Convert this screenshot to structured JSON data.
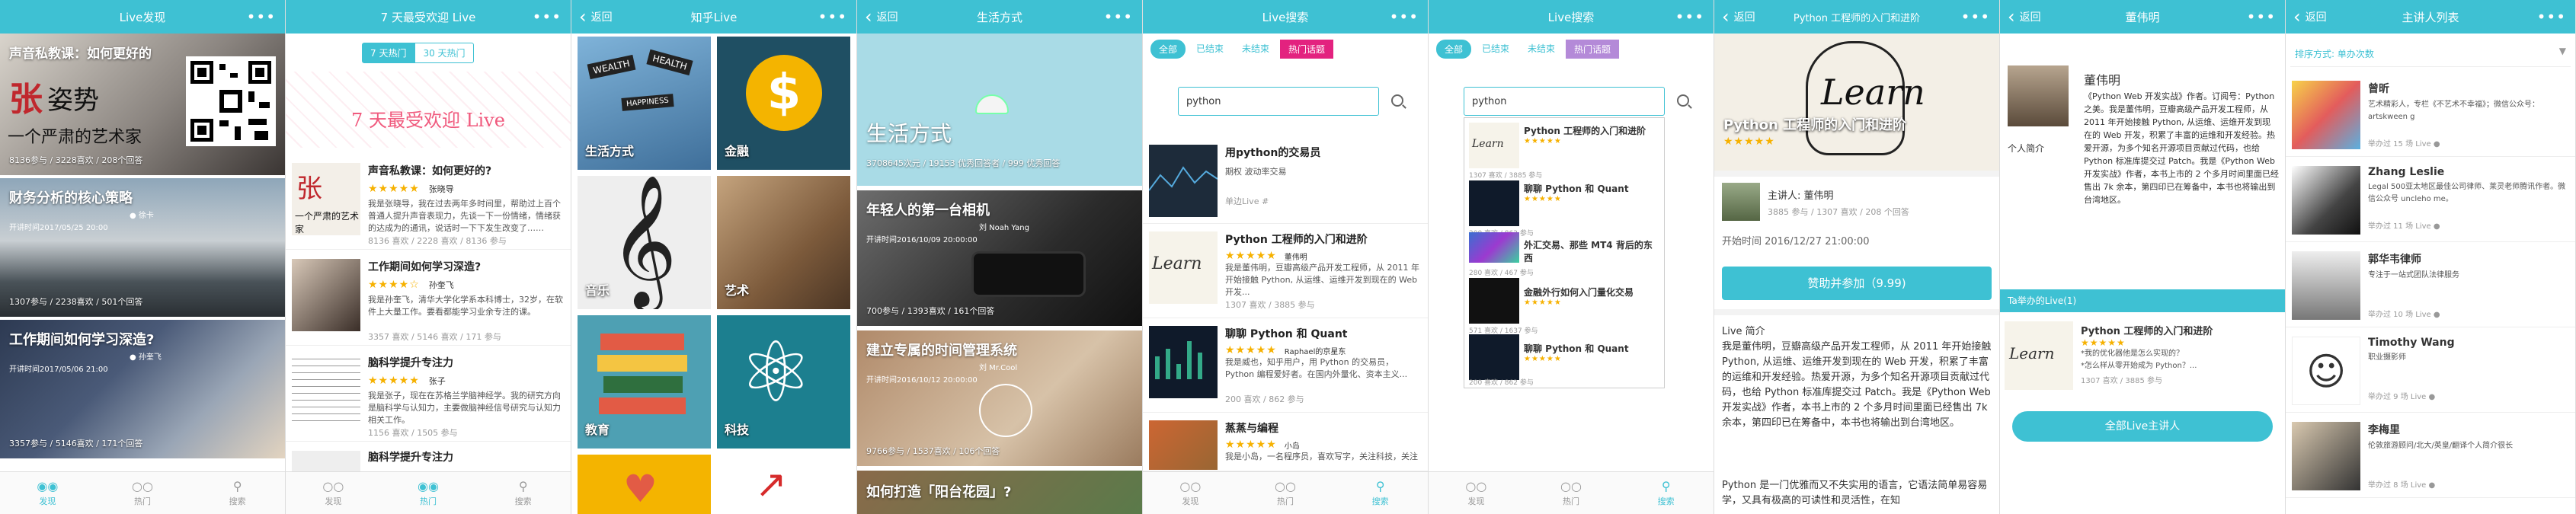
{
  "s1": {
    "title": "Live发现",
    "dots": "•••",
    "card1": {
      "title": "声音私教课：如何更好的",
      "meta": "8136参与 / 3228喜欢 / 208个回答",
      "logo_chars": "张",
      "tagline": "一个严肃的艺术家"
    },
    "card2": {
      "title": "财务分析的核心策略",
      "who": "● 徐卡",
      "date": "开讲时间2017/05/25 20:00",
      "meta": "1307参与 / 2238喜欢 / 501个回答"
    },
    "card3": {
      "title": "工作期间如何学习深造?",
      "who": "● 孙奎飞",
      "date": "开讲时间2017/05/06 21:00",
      "meta": "3357参与 / 5146喜欢 / 171个回答"
    },
    "tabs": [
      "发现",
      "热门",
      "搜索"
    ]
  },
  "s2": {
    "title": "7 天最受欢迎 Live",
    "dots": "•••",
    "seg": [
      "7 天热门",
      "30 天热门"
    ],
    "headline": "7 天最受欢迎 Live",
    "items": [
      {
        "title": "声音私教课：如何更好的?",
        "who": "张晓导",
        "desc": "我是张晓导，我在过去两年多时间里，帮助过上百个普通人提升声音表现力，先谈一下一份情绪，情绪获的达成为的通讯，说话时一下下发生改变了……",
        "meta": "8136 喜欢 / 2228 喜欢 / 8136 参与"
      },
      {
        "title": "工作期间如何学习深造?",
        "who": "孙奎飞",
        "desc": "我是孙奎飞，清华大学化学系本科博士，32岁，在软件上大量工作。要看都能学习业余专注的课。",
        "meta": "3357 喜欢 / 5146 喜欢 / 171 参与"
      },
      {
        "title": "脑科学提升专注力",
        "who": "张子",
        "desc": "我是张子，现在在苏格兰学脑神经学。我的研究方向是脑科学与认知力，主要做脑神经信号研究与认知力相关工作。",
        "meta": "1156 喜欢 / 1505 参与"
      },
      {
        "title": "脑科学提升专注力"
      }
    ],
    "tabs": [
      "发现",
      "热门",
      "搜索"
    ]
  },
  "s3": {
    "title": "知乎Live",
    "dots": "•••",
    "tiles": [
      "生活方式",
      "金融",
      "音乐",
      "艺术",
      "教育",
      "科技",
      "",
      ""
    ],
    "tabs": [
      "发现",
      "热门",
      "搜索"
    ]
  },
  "s4": {
    "title": "生活方式",
    "back": "返回",
    "dots": "•••",
    "hero": {
      "title": "生活方式",
      "meta": "3708645次元 / 19153 优秀回答者 / 999 优秀回答"
    },
    "card1": {
      "title": "年轻人的第一台相机",
      "who": "刘 Noah Yang",
      "date": "开讲时间2016/10/09 20:00:00",
      "meta": "700参与 / 1393喜欢 / 161个回答"
    },
    "card2": {
      "title": "建立专属的时间管理系统",
      "who": "刘 Mr.Cool",
      "date": "开讲时间2016/10/12 20:00:00",
      "meta": "9766参与 / 1537喜欢 / 106个回答"
    },
    "card3": {
      "title": "如何打造「阳台花园」?"
    }
  },
  "s5": {
    "title": "Live搜索",
    "dots": "•••",
    "filters": [
      "全部",
      "已结束",
      "未结束",
      "热门话题"
    ],
    "query": "python",
    "items": [
      {
        "title": "用python的交易员",
        "desc": "期权 波动率交易",
        "meta": "单边Live #"
      },
      {
        "title": "Python 工程师的入门和进阶",
        "who": "董伟明",
        "stars": "★★★★★",
        "desc": "我是董伟明，豆瓣高级产品开发工程师，从 2011 年开始接触 Python, 从运维、运维开发到现在的 Web 开发...",
        "meta": "1307 喜欢 / 3885 参与"
      },
      {
        "title": "聊聊 Python 和 Quant",
        "who": "Raphael的京星东",
        "stars": "★★★★★",
        "desc": "我是威也，知乎用户，用 Python 的交易员，Python 编程爱好者。在国内外量化、资本主义...",
        "meta": "200 喜欢 / 862 参与"
      },
      {
        "title": "蒸蒸与编程",
        "who": "小岛",
        "stars": "★★★★★",
        "desc": "我是小岛，一名程序员，喜欢写字，关注科技，关注书法与编程的相似之处...",
        "meta": "1307 喜欢 / 3885 参与"
      }
    ],
    "tabs": [
      "发现",
      "热门",
      "搜索"
    ]
  },
  "s6": {
    "title": "Live搜索",
    "dots": "•••",
    "filters": [
      "全部",
      "已结束",
      "未结束",
      "热门话题"
    ],
    "query": "python",
    "items": [
      {
        "title": "Python 工程师的入门和进阶",
        "meta": "1307 喜欢 / 3885 参与"
      },
      {
        "title": "聊聊 Python 和 Quant",
        "meta": "200 喜欢 / 862 参与"
      },
      {
        "title": "外汇交易、那些 MT4 背后的东西",
        "meta": "280 喜欢 / 467 参与"
      },
      {
        "title": "金融外行如何入门量化交易",
        "meta": "571 喜欢 / 1637 参与"
      },
      {
        "title": "聊聊 Python 和 Quant",
        "meta": "200 喜欢 / 862 参与"
      }
    ],
    "tabs": [
      "发现",
      "热门",
      "搜索"
    ]
  },
  "s7": {
    "title": "Python 工程师的入门和进阶",
    "back": "返回",
    "dots": "•••",
    "hero_word": "Learn",
    "hero_title": "Python 工程师的入门和进阶",
    "stars": "★★★★★",
    "speaker_label": "主讲人: 董伟明",
    "speaker_meta": "3885 参与 / 1307 喜欢 / 208 个回答",
    "start": "开始时间 2016/12/27 21:00:00",
    "join": "赞助并参加（9.99)",
    "intro_label": "Live 简介",
    "intro": "我是董伟明，豆瓣高级产品开发工程师，从 2011 年开始接触 Python, 从运维、运维开发到现在的 Web 开发，积累了丰富的运维和开发经验。热爱开源，为多个知名开源项目贡献过代码，也给 Python 标准库提交过 Patch。我是《Python Web 开发实战》作者，本书上市的 2 个多月时间里面已经售出 7k 余本，第四印已在筹备中，本书也将输出到台湾地区。",
    "intro2": "Python 是一门优雅而又不失实用的语言，它语法简单易容易学，又具有极高的可读性和灵活性，在知"
  },
  "s8": {
    "title": "董伟明",
    "back": "返回",
    "dots": "•••",
    "name": "董伟明",
    "bio": "《Python Web 开发实战》作者。订阅号：Python 之美。我是董伟明，豆瓣高级产品开发工程师，从 2011 年开始接触 Python, 从运维、运维开发到现在的 Web 开发，积累了丰富的运维和开发经验。热爱开源，为多个知名开源项目贡献过代码，也给 Python 标准库提交过 Patch。我是《Python Web 开发实战》作者，本书上市的 2 个多月时间里面已经售出 7k 余本，第四印已在筹备中，本书也将输出到台湾地区。",
    "profile_label": "个人简介",
    "section": "Ta举办的Live(1)",
    "live": {
      "title": "Python 工程师的入门和进阶",
      "stars": "★★★★★",
      "desc": "*我的优化器他是怎么实现的？\n*怎么样从零开始成为 Python？...",
      "meta": "1307 喜欢 / 3885 参与"
    },
    "all_button": "全部Live主讲人"
  },
  "s9": {
    "title": "主讲人列表",
    "back": "返回",
    "dots": "•••",
    "sort": "排序方式: 单办次数",
    "people": [
      {
        "name": "曾昕",
        "desc": "艺术精彩人，专栏《不艺术不幸福》；微信公众号：artskween g",
        "meta": "举办过 15 场 Live ●"
      },
      {
        "name": "Zhang Leslie",
        "desc": "Legal 500亚太地区最佳公司律师、莱灵老师腾讯作者。微信公众号 uncleho me。",
        "meta": "举办过 11 场 Live ●"
      },
      {
        "name": "郭华韦律师",
        "desc": "专注于一站式团队法律服务",
        "meta": "举办过 10 场 Live ●"
      },
      {
        "name": "Timothy Wang",
        "desc": "职业摄影师",
        "meta": "举办过 9 场 Live ●"
      },
      {
        "name": "李梅里",
        "desc": "伦敦旅游顾问/北大/英皇/翻译个人简介很长",
        "meta": "举办过 8 场 Live ●"
      }
    ]
  }
}
